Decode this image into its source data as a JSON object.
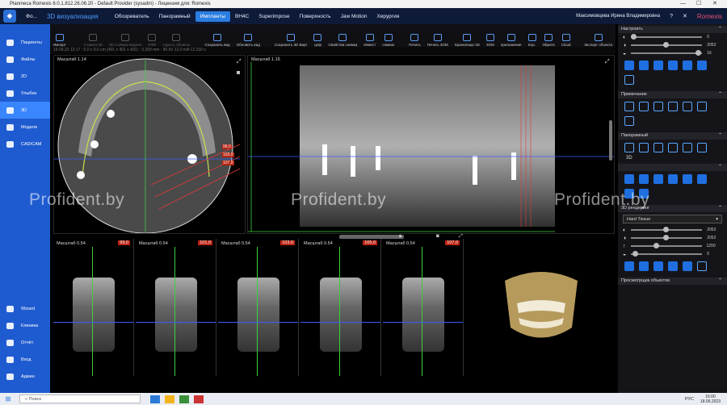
{
  "titlebar": {
    "text": "Planmeca Romexis 6.0.1.812.26.06.20 - Default Provider (sysadm) - Лицензия для: Romexis",
    "minimize": "—",
    "maximize": "☐",
    "close": "✕"
  },
  "menubar": {
    "app_mode": "Фо...",
    "title": "3D визуализация",
    "tabs": [
      "Обозреватель",
      "Панорамный",
      "Импланты",
      "ВН4С",
      "Superimpose",
      "Поверхность",
      "Jaw Motion",
      "Хирургия"
    ],
    "active_tab": "Импланты",
    "user": "Максимовцева Ирина Владимировна",
    "brand": "Romexis"
  },
  "toolbar": {
    "buttons": [
      {
        "label": "Импорт",
        "disabled": false
      },
      {
        "label": "Съёмка 3D",
        "disabled": true
      },
      {
        "label": "3D Съёмка модели",
        "disabled": true
      },
      {
        "label": "ФФФ",
        "disabled": true
      },
      {
        "label": "Скрыть объекты",
        "disabled": true
      },
      {
        "label": "Сохранить вид",
        "disabled": false
      },
      {
        "label": "Обновить вид",
        "disabled": false
      },
      {
        "label": "Сохранить 3D Вирт",
        "disabled": false
      },
      {
        "label": "цеф",
        "disabled": false
      },
      {
        "label": "Свойства снимка",
        "disabled": false
      },
      {
        "label": "Инвест",
        "disabled": false
      },
      {
        "label": "снимок",
        "disabled": false
      },
      {
        "label": "Печать",
        "disabled": false
      },
      {
        "label": "Печать 3OM",
        "disabled": false
      },
      {
        "label": "Хранилище 3D",
        "disabled": false
      },
      {
        "label": "3OM",
        "disabled": false
      },
      {
        "label": "приложение",
        "disabled": false
      },
      {
        "label": "Exp.",
        "disabled": false
      },
      {
        "label": "Objects",
        "disabled": false
      },
      {
        "label": "Cloud",
        "disabled": false
      },
      {
        "label": "Экспорт объекта",
        "disabled": false
      }
    ]
  },
  "sidebar": {
    "items": [
      {
        "label": "Пациенты"
      },
      {
        "label": "Файлы"
      },
      {
        "label": "2D"
      },
      {
        "label": "Улыбка"
      },
      {
        "label": "3D",
        "active": true
      },
      {
        "label": "Модели"
      },
      {
        "label": "CAD/CAM"
      }
    ],
    "bottom_items": [
      {
        "label": "Wizard"
      },
      {
        "label": "Клиника"
      },
      {
        "label": "Отчёт"
      },
      {
        "label": "Вход"
      },
      {
        "label": "Админ"
      }
    ]
  },
  "statusline": "19.09.22 12:17 : 0.0 x 0.0 cm (401 x 401 x 401) : 0.200 mm : 90 kV 12.0 mA 12.150 s",
  "views": {
    "axial": {
      "label": "Масштаб 1.14",
      "measures": [
        "99,0",
        "103,0",
        "107,0"
      ]
    },
    "panoramic": {
      "label": "Масштаб 1.16"
    }
  },
  "slices": [
    {
      "label": "Масштаб 0.54",
      "number": "99,0"
    },
    {
      "label": "Масштаб 0.54",
      "number": "101,0"
    },
    {
      "label": "Масштаб 0.54",
      "number": "103,0"
    },
    {
      "label": "Масштаб 0.54",
      "number": "105,0"
    },
    {
      "label": "Масштаб 0.54",
      "number": "107,0"
    }
  ],
  "right_panel": {
    "sections": [
      "Настроить",
      "Примечание",
      "Панорамный",
      "3D рендеринг",
      "Просмотрщик объектов"
    ],
    "settings_values": [
      "0",
      "2052",
      "16"
    ],
    "render_mode": "Hard Tissue",
    "render_values": [
      "2052",
      "2052",
      "1200",
      "0"
    ],
    "panoramic_3d_label": "3D"
  },
  "watermark": "Profident.by",
  "taskbar": {
    "search": "Поиск",
    "lang": "РУС",
    "time": "16:00",
    "date": "18.05.2023"
  },
  "colors": {
    "menubar_bg": "#0d1a38",
    "sidebar_bg": "#1f5bd0",
    "accent": "#2a7de1",
    "measure_red": "#b21111"
  }
}
